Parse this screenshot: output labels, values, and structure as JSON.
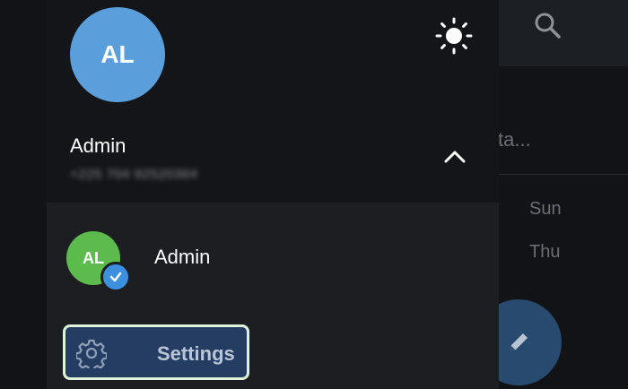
{
  "background": {
    "preview_snippet": "ta...",
    "days": [
      "Sun",
      "Thu"
    ],
    "icons": [
      "search-icon",
      "pencil-icon"
    ]
  },
  "drawer": {
    "avatar_initials": "AL",
    "user_name": "Admin",
    "phone": "+225 704 92520364",
    "theme_icon": "sun-icon",
    "expand_icon": "chevron-up-icon",
    "accounts": [
      {
        "initials": "AL",
        "name": "Admin",
        "verified": true
      }
    ],
    "menu": [
      {
        "label": "Settings",
        "icon": "gear-icon",
        "selected": true
      }
    ]
  },
  "colors": {
    "accent_avatar": "#5a9fdc",
    "account_avatar": "#5dbb4d",
    "selected_item_bg": "#263d63",
    "selection_outline": "#dff4d8"
  }
}
